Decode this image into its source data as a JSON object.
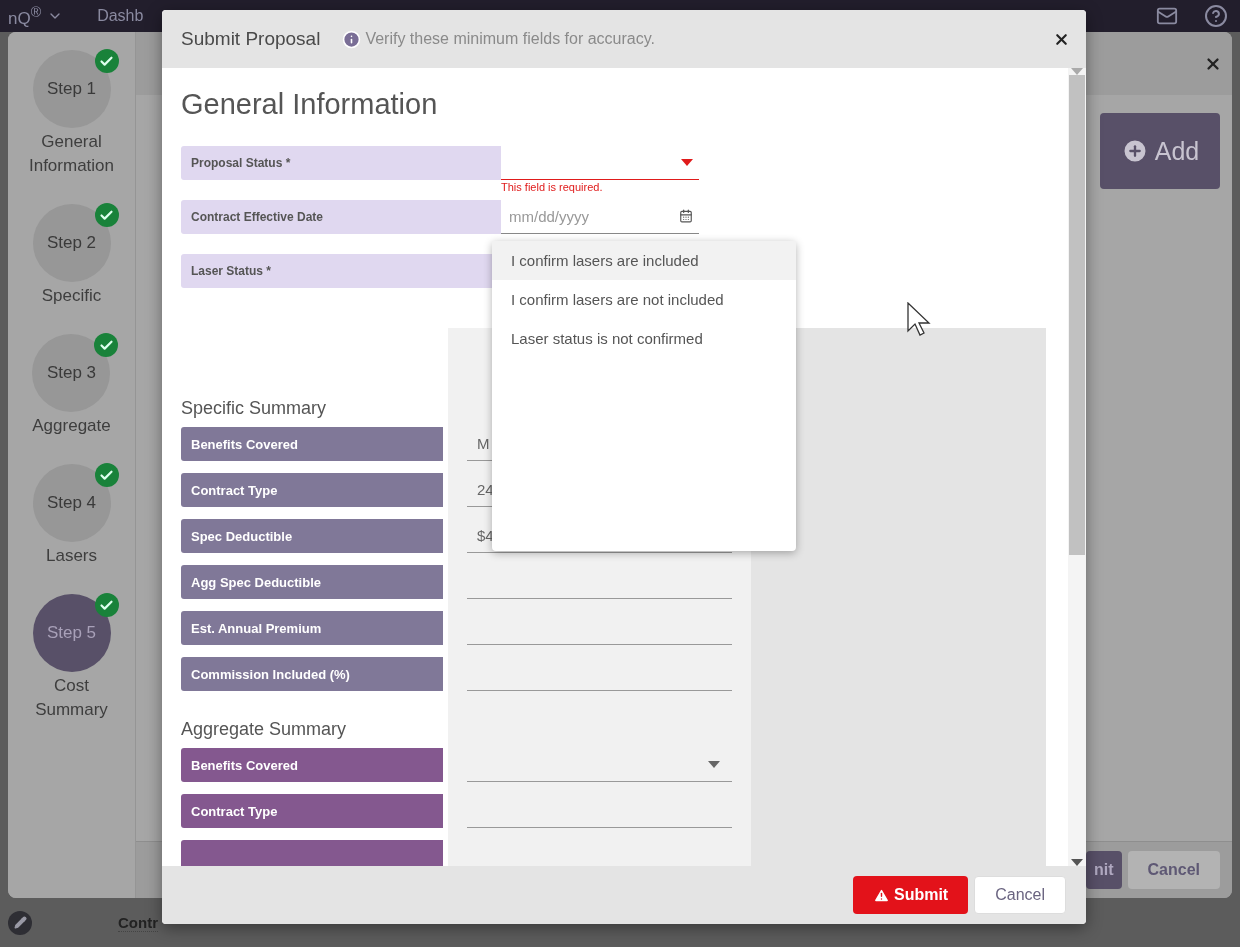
{
  "app_bar": {
    "brand": "nQ$^{®}$",
    "nav_item": "Dashb"
  },
  "wizard": {
    "steps": [
      {
        "number": "Step 1",
        "label": "General Information",
        "completed": true,
        "selected": false
      },
      {
        "number": "Step 2",
        "label": "Specific",
        "completed": true,
        "selected": false
      },
      {
        "number": "Step 3",
        "label": "Aggregate",
        "completed": true,
        "selected": false
      },
      {
        "number": "Step 4",
        "label": "Lasers",
        "completed": true,
        "selected": false
      },
      {
        "number": "Step 5",
        "label": "Cost Summary",
        "completed": true,
        "selected": true
      }
    ],
    "add_button": "Add",
    "footer_buttons": [
      {
        "label": "nit",
        "kind": "primary"
      },
      {
        "label": "Cancel",
        "kind": "secondary"
      }
    ]
  },
  "background_table": {
    "column_header": "Contr"
  },
  "modal": {
    "title": "Submit Proposal",
    "hint": "Verify these minimum fields for accuracy.",
    "general": {
      "heading": "General Information",
      "fields": [
        {
          "label": "Proposal Status *",
          "kind": "select",
          "error": "This field is required."
        },
        {
          "label": "Contract Effective Date",
          "kind": "date",
          "placeholder": "mm/dd/yyyy"
        },
        {
          "label": "Laser Status *",
          "kind": "select",
          "open": true,
          "options": [
            {
              "label": "I confirm lasers are included",
              "highlighted": true
            },
            {
              "label": "I confirm lasers are not included",
              "highlighted": false
            },
            {
              "label": "Laser status is not confirmed",
              "highlighted": false
            }
          ]
        }
      ]
    },
    "specific": {
      "heading": "Specific Summary",
      "fields": [
        {
          "label": "Benefits Covered",
          "kind": "text",
          "value": "M"
        },
        {
          "label": "Contract Type",
          "kind": "text",
          "value": "24"
        },
        {
          "label": "Spec Deductible",
          "kind": "text",
          "value": "$4"
        },
        {
          "label": "Agg Spec Deductible",
          "kind": "text"
        },
        {
          "label": "Est. Annual Premium",
          "kind": "text"
        },
        {
          "label": "Commission Included (%)",
          "kind": "text"
        }
      ]
    },
    "aggregate": {
      "heading": "Aggregate Summary",
      "fields": [
        {
          "label": "Benefits Covered",
          "kind": "select"
        },
        {
          "label": "Contract Type",
          "kind": "text"
        },
        {
          "kind": "text"
        }
      ]
    },
    "buttons": [
      {
        "label": "Submit",
        "kind": "primary"
      },
      {
        "label": "Cancel",
        "kind": "secondary"
      }
    ]
  }
}
